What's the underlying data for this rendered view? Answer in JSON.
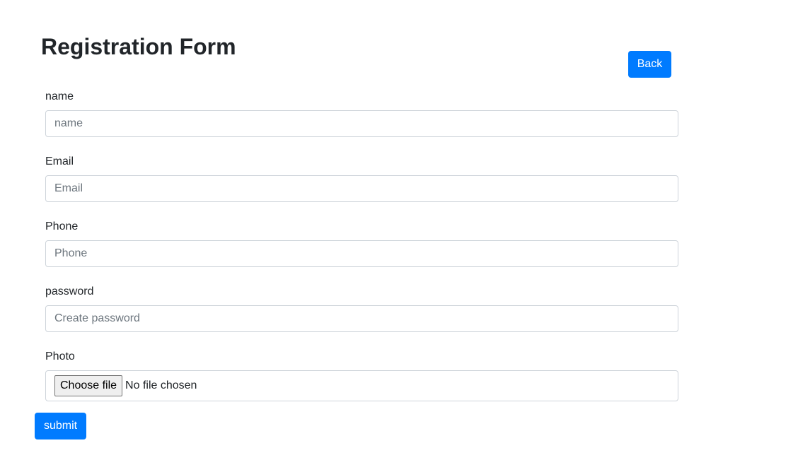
{
  "page": {
    "title": "Registration Form"
  },
  "actions": {
    "back_label": "Back",
    "submit_label": "submit"
  },
  "form": {
    "name": {
      "label": "name",
      "placeholder": "name",
      "value": ""
    },
    "email": {
      "label": "Email",
      "placeholder": "Email",
      "value": ""
    },
    "phone": {
      "label": "Phone",
      "placeholder": "Phone",
      "value": ""
    },
    "password": {
      "label": "password",
      "placeholder": "Create password",
      "value": ""
    },
    "photo": {
      "label": "Photo",
      "button_label": "Choose file",
      "status": "No file chosen"
    }
  },
  "colors": {
    "primary": "#007bff",
    "input_border": "#ced4da",
    "text": "#212529",
    "placeholder": "#6c757d"
  }
}
